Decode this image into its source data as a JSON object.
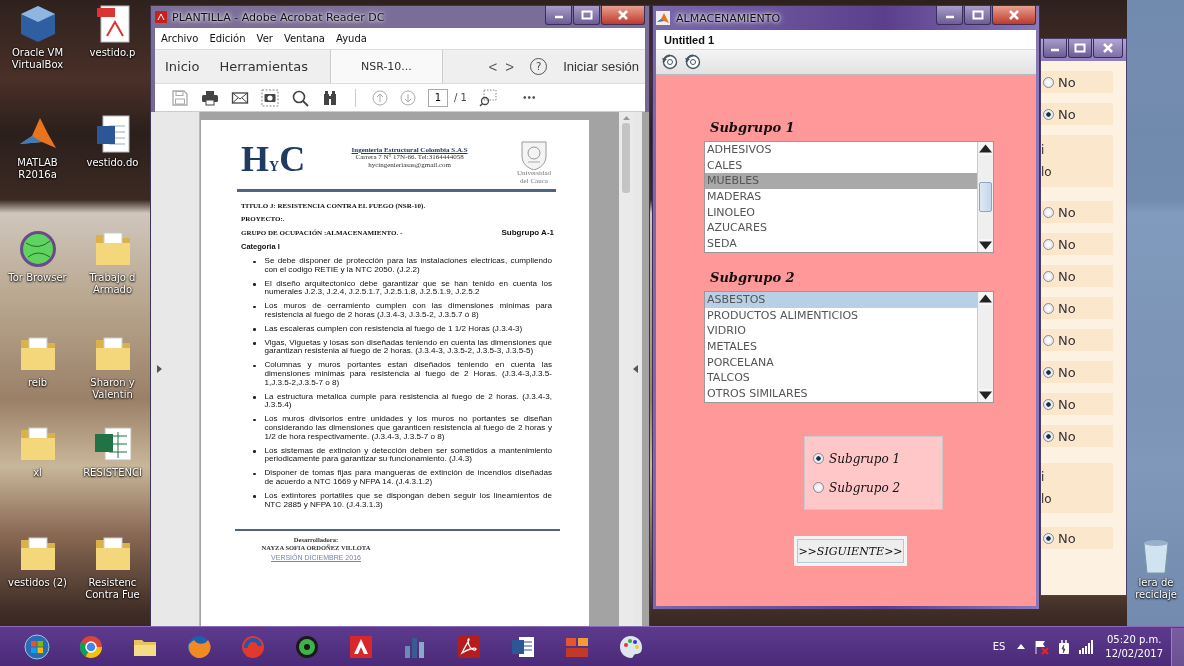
{
  "desktop": {
    "icons": [
      {
        "kind": "cube",
        "label": "Oracle VM VirtualBox"
      },
      {
        "kind": "pdf",
        "label": "vestido.p"
      },
      {
        "kind": "peak",
        "label": "MATLAB R2016a"
      },
      {
        "kind": "word",
        "label": "vestido.do"
      },
      {
        "kind": "globe",
        "label": "Tor Browser"
      },
      {
        "kind": "folder",
        "label": "Trabajo d Armado"
      },
      {
        "kind": "folder",
        "label": "reib"
      },
      {
        "kind": "folder",
        "label": "Sharon y Valentin"
      },
      {
        "kind": "folder",
        "label": "xl"
      },
      {
        "kind": "excel",
        "label": "RESISTENCI"
      },
      {
        "kind": "folder",
        "label": "vestidos (2)"
      },
      {
        "kind": "folder",
        "label": "Resistenc Contra Fue"
      }
    ],
    "recycle_bin": {
      "label": "lera de reciclaje"
    }
  },
  "acrobat": {
    "title": "PLANTILLA - Adobe Acrobat Reader DC",
    "menu": [
      "Archivo",
      "Edición",
      "Ver",
      "Ventana",
      "Ayuda"
    ],
    "tabs": [
      {
        "label": "Inicio",
        "selected": false
      },
      {
        "label": "Herramientas",
        "selected": false
      },
      {
        "label": "NSR-10...",
        "selected": true
      }
    ],
    "nav_prev": "<",
    "nav_next": ">",
    "help": "?",
    "sign_in": "Iniciar sesión",
    "page_number": "1",
    "page_total": "/ 1",
    "more": "•••",
    "document": {
      "logo": "H$_{Y}$C",
      "company": "Ingenieria Estructural Colombia S.A.S",
      "address": "Carrera 7 N° 17N-66. Tel:3164444058",
      "email": "hycingenieriasas@gmail.com",
      "seal_caption": "Universidad del Cauca",
      "title": "TITULO J: RESISTENCIA CONTRA EL FUEGO (NSR-10).",
      "project": "PROYECTO:.",
      "group": "GRUPO DE OCUPACIÓN :ALMACENAMIENTO. -",
      "subgroup": "Subgrupo A-1",
      "category": "Categoria I",
      "bullets": [
        "Se debe disponer de protección para las instalaciones electricas, cumpliendo con el codigo RETIE y la NTC 2050. (J.2.2)",
        "El diseño arquitectonico debe garantizar que se han tenido en cuenta los numerales J.2.3, J.2.4, J.2.5.1.7, J.2.5.1.8, J.2.5.1.9, J.2.5.2",
        "Los muros de cerramiento cumplen con las dimensiones minimas para resistencia al fuego de 2 horas (J.3.4-3, J.3.5-2, J.3.5.7 ó 8)",
        "Las escaleras cumplen con resistencia al fuego de 1 1/2 Horas (J.3.4-3)",
        "Vigas, Viguetas y losas son diseñadas teniendo en cuenta las dimensiones que garantizan resistenia al fuego de 2 horas. (J.3.4-3, J.3.5-2, J.3.5-3, J.3.5-5)",
        "Columnas y muros portantes estan diseñados teniendo en cuenta las dimensiones minimas para resistencia al fuego de 2 Horas. (J.3.4-3,J.3.5-1,J.3.5-2,J.3.5-7 o 8)",
        "La estructura metalica cumple para resistencia al fuego de 2 horas. (J.3.4-3, J.3.5.4)",
        "Los muros divisorios entre unidades y los muros no portantes se diseñan considerando las dimensiones que garanticen resistencia al fuego de 2 horas y 1/2 de hora respectivamente. (J.3.4-3, J.3.5-7 o 8)",
        "Los sistemas de extincion y detección deben ser sometidos a mantenimiento periodicamente para garantizar su funcionamiento. (J.4.3)",
        "Disponer de tomas fijas para mangueras de extinción de incendios diseñadas de acuerdo a NTC 1669 y NFPA 14. (J.4.3.1.2)",
        "Los extintores portatiles que se dispongan deben seguir los lineamientos de NTC 2885 y NFPA 10. (J.4.3.1.3)"
      ],
      "developer_label": "Desarrolladora:",
      "developer": "NAYZA SOFIA ORDOÑEZ VILLOTA",
      "version": "VERSIÓN DICIEMBRE 2016"
    }
  },
  "background_window": {
    "options": [
      {
        "kind": "radio",
        "label": "No",
        "selected": false
      },
      {
        "kind": "radio",
        "label": "No",
        "selected": true
      },
      {
        "kind": "partial",
        "lines": [
          "i",
          "lo"
        ]
      },
      {
        "kind": "radio",
        "label": "No",
        "selected": false
      },
      {
        "kind": "radio",
        "label": "No",
        "selected": false
      },
      {
        "kind": "radio",
        "label": "No",
        "selected": false
      },
      {
        "kind": "radio",
        "label": "No",
        "selected": false
      },
      {
        "kind": "radio",
        "label": "No",
        "selected": false
      },
      {
        "kind": "radio",
        "label": "No",
        "selected": true
      },
      {
        "kind": "radio",
        "label": "No",
        "selected": true
      },
      {
        "kind": "radio",
        "label": "No",
        "selected": true
      },
      {
        "kind": "partial",
        "lines": [
          "i",
          "lo"
        ]
      },
      {
        "kind": "radio",
        "label": "No",
        "selected": true
      }
    ]
  },
  "matlab_window": {
    "title": "ALMACENAMIENTO",
    "figure_name": "Untitled 1",
    "list_1": {
      "label": "Subgrupo 1",
      "items": [
        {
          "text": "ADHESIVOS",
          "selected": false
        },
        {
          "text": "CALES",
          "selected": false
        },
        {
          "text": "MUEBLES",
          "selected": true
        },
        {
          "text": "MADERAS",
          "selected": false
        },
        {
          "text": "LINOLEO",
          "selected": false
        },
        {
          "text": "AZUCARES",
          "selected": false
        },
        {
          "text": "SEDA",
          "selected": false
        }
      ]
    },
    "list_2": {
      "label": "Subgrupo 2",
      "items": [
        {
          "text": "ASBESTOS",
          "selected": true
        },
        {
          "text": "PRODUCTOS ALIMENTICIOS",
          "selected": false
        },
        {
          "text": "VIDRIO",
          "selected": false
        },
        {
          "text": "METALES",
          "selected": false
        },
        {
          "text": "PORCELANA",
          "selected": false
        },
        {
          "text": "TALCOS",
          "selected": false
        },
        {
          "text": "OTROS SIMILARES",
          "selected": false
        }
      ]
    },
    "radios": [
      {
        "label": "Subgrupo 1",
        "selected": true
      },
      {
        "label": "Subgrupo 2",
        "selected": false
      }
    ],
    "next_button": ">>SIGUIENTE>>"
  },
  "taskbar": {
    "apps": [
      {
        "kind": "start"
      },
      {
        "kind": "ring"
      },
      {
        "kind": "folder"
      },
      {
        "kind": "globe"
      },
      {
        "kind": "swirl"
      },
      {
        "kind": "disc"
      },
      {
        "kind": "triangle"
      },
      {
        "kind": "bars"
      },
      {
        "kind": "curve"
      },
      {
        "kind": "word"
      },
      {
        "kind": "brick"
      },
      {
        "kind": "palette"
      }
    ],
    "language": "ES",
    "time": "05:20 p.m.",
    "date": "12/02/2017"
  }
}
